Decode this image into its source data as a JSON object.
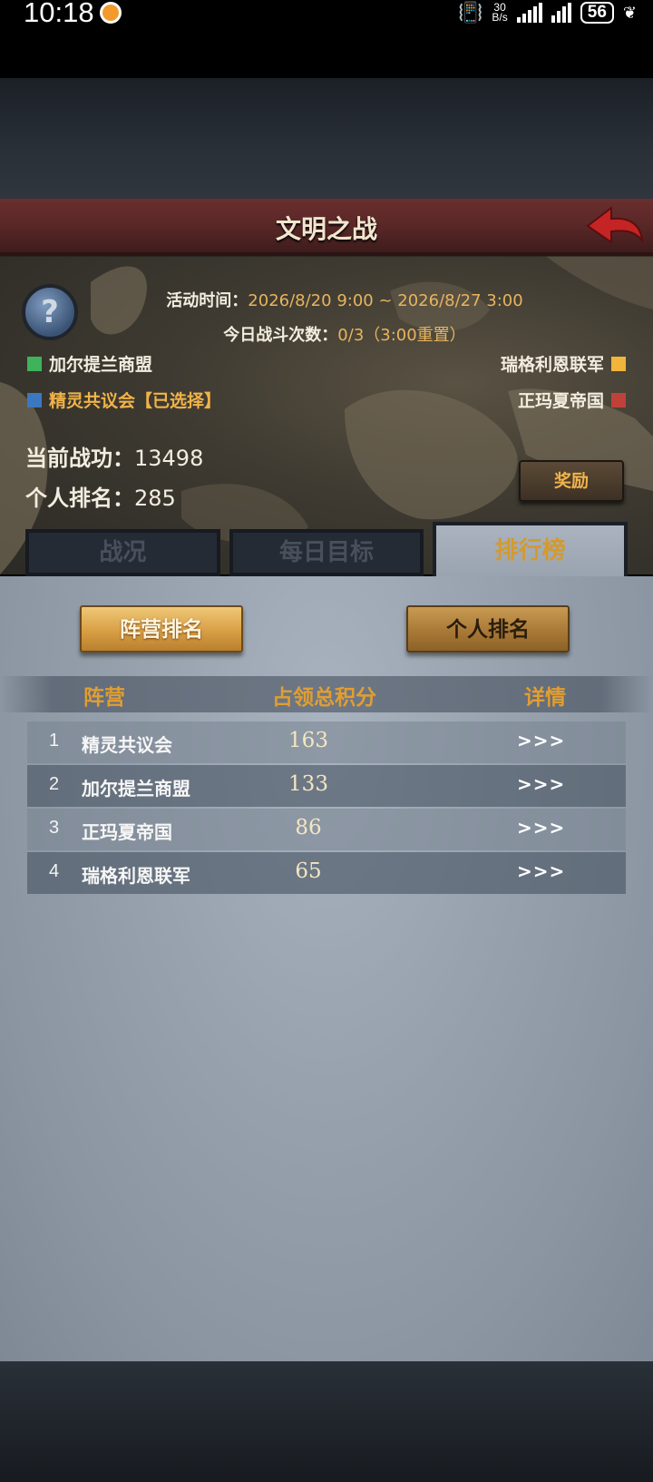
{
  "status_bar": {
    "time": "10:18",
    "net_speed_value": "30",
    "net_speed_unit": "B/s",
    "battery": "56"
  },
  "header": {
    "title": "文明之战",
    "back_icon": "back-arrow-icon"
  },
  "info": {
    "help_glyph": "?",
    "event_time_label": "活动时间：",
    "event_time_value": "2026/8/20 9:00 ~ 2026/8/27 3:00",
    "battle_count_label": "今日战斗次数：",
    "battle_count_value": "0/3（3:00重置）",
    "merit_label": "当前战功：",
    "merit_value": "13498",
    "rank_label": "个人排名：",
    "rank_value": "285",
    "reward_label": "奖励"
  },
  "factions": [
    {
      "name": "加尔提兰商盟",
      "color": "#3fb25a"
    },
    {
      "name": "精灵共议会【已选择】",
      "color": "#3b78c0",
      "selected": true
    },
    {
      "name": "瑞格利恩联军",
      "color": "#f0b53a"
    },
    {
      "name": "正玛夏帝国",
      "color": "#c0413a"
    }
  ],
  "tabs": [
    {
      "label": "战况",
      "active": false
    },
    {
      "label": "每日目标",
      "active": false
    },
    {
      "label": "排行榜",
      "active": true
    }
  ],
  "sub_tabs": {
    "camp_rank": "阵营排名",
    "personal_rank": "个人排名"
  },
  "table": {
    "headers": {
      "camp": "阵营",
      "score": "占领总积分",
      "detail": "详情"
    },
    "rows": [
      {
        "rank": "1",
        "name": "精灵共议会",
        "score": "163",
        "detail": ">>>"
      },
      {
        "rank": "2",
        "name": "加尔提兰商盟",
        "score": "133",
        "detail": ">>>"
      },
      {
        "rank": "3",
        "name": "正玛夏帝国",
        "score": "86",
        "detail": ">>>"
      },
      {
        "rank": "4",
        "name": "瑞格利恩联军",
        "score": "65",
        "detail": ">>>"
      }
    ]
  }
}
